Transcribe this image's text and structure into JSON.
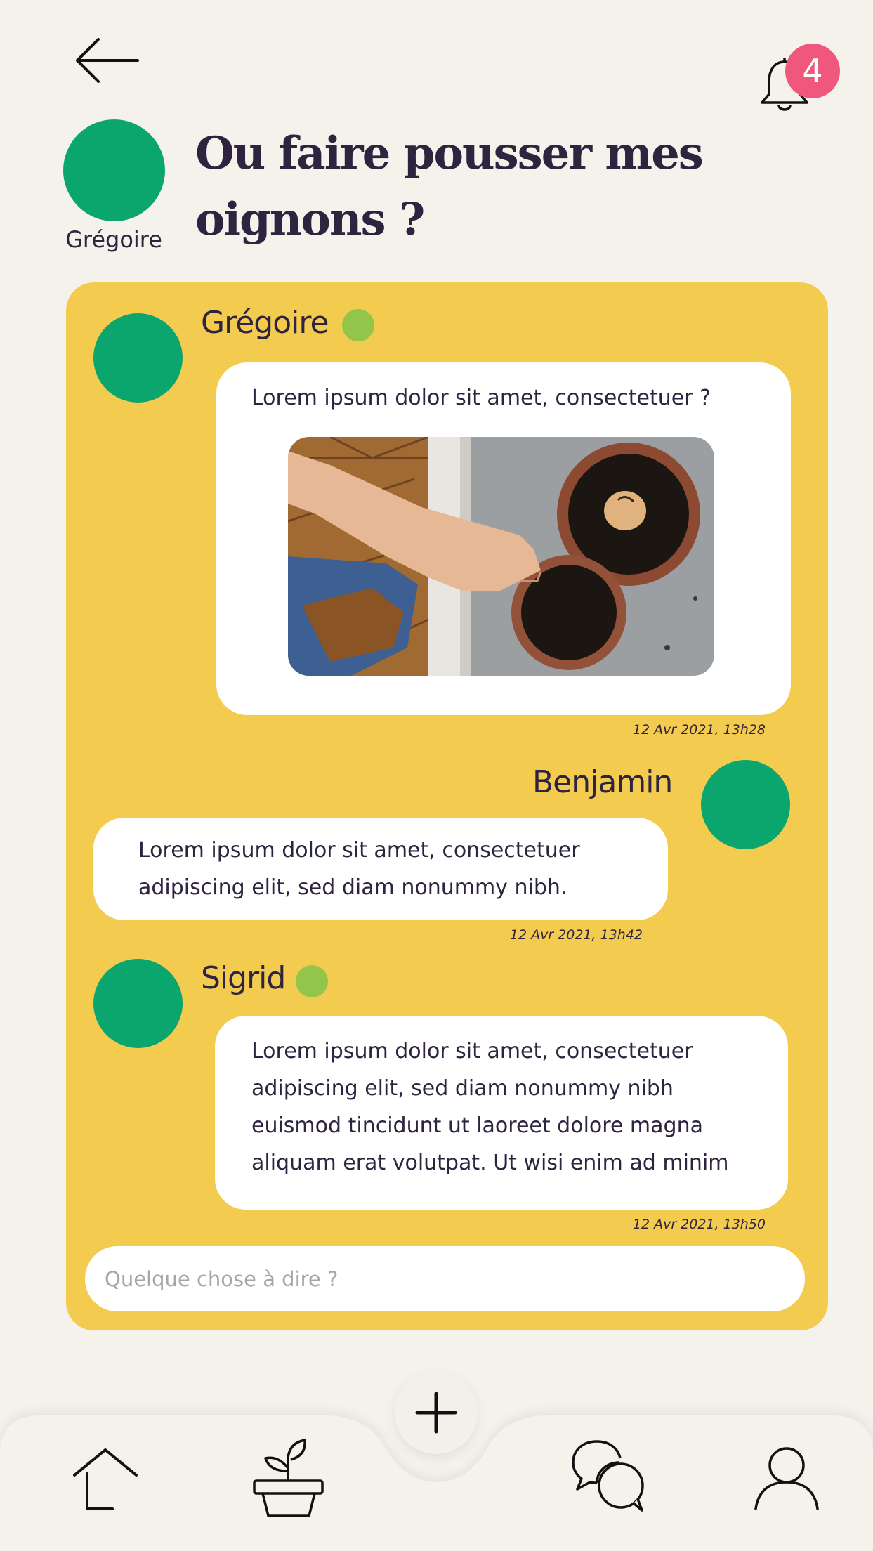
{
  "header": {
    "back_icon": "arrow-left-icon",
    "notification_icon": "bell-icon",
    "notification_count": "4",
    "title": "Ou faire pousser mes oignons ?",
    "author": "Grégoire"
  },
  "messages": [
    {
      "author": "Grégoire",
      "online": true,
      "text": "Lorem ipsum dolor sit amet, consectetuer ?",
      "has_photo": true,
      "timestamp": "12 Avr 2021, 13h28"
    },
    {
      "author": "Benjamin",
      "online": false,
      "lines": [
        "Lorem ipsum dolor sit amet, consectetuer",
        "adipiscing elit, sed diam nonummy nibh."
      ],
      "timestamp": "12 Avr 2021, 13h42"
    },
    {
      "author": "Sigrid",
      "online": true,
      "lines": [
        "Lorem ipsum dolor sit amet, consectetuer",
        "adipiscing elit, sed diam nonummy nibh",
        "euismod tincidunt ut laoreet dolore magna",
        "aliquam erat volutpat. Ut wisi enim ad minim"
      ],
      "timestamp": "12 Avr 2021, 13h50"
    }
  ],
  "composer": {
    "placeholder": "Quelque chose à dire ?"
  },
  "nav": {
    "items": [
      "home-icon",
      "plant-pot-icon",
      "add-icon",
      "chat-bubbles-icon",
      "user-profile-icon"
    ]
  },
  "colors": {
    "background": "#f5f2ec",
    "panel": "#f3cb4f",
    "avatar": "#0aa66e",
    "online": "#94c54b",
    "badge": "#f0577c",
    "text": "#2f2440"
  }
}
